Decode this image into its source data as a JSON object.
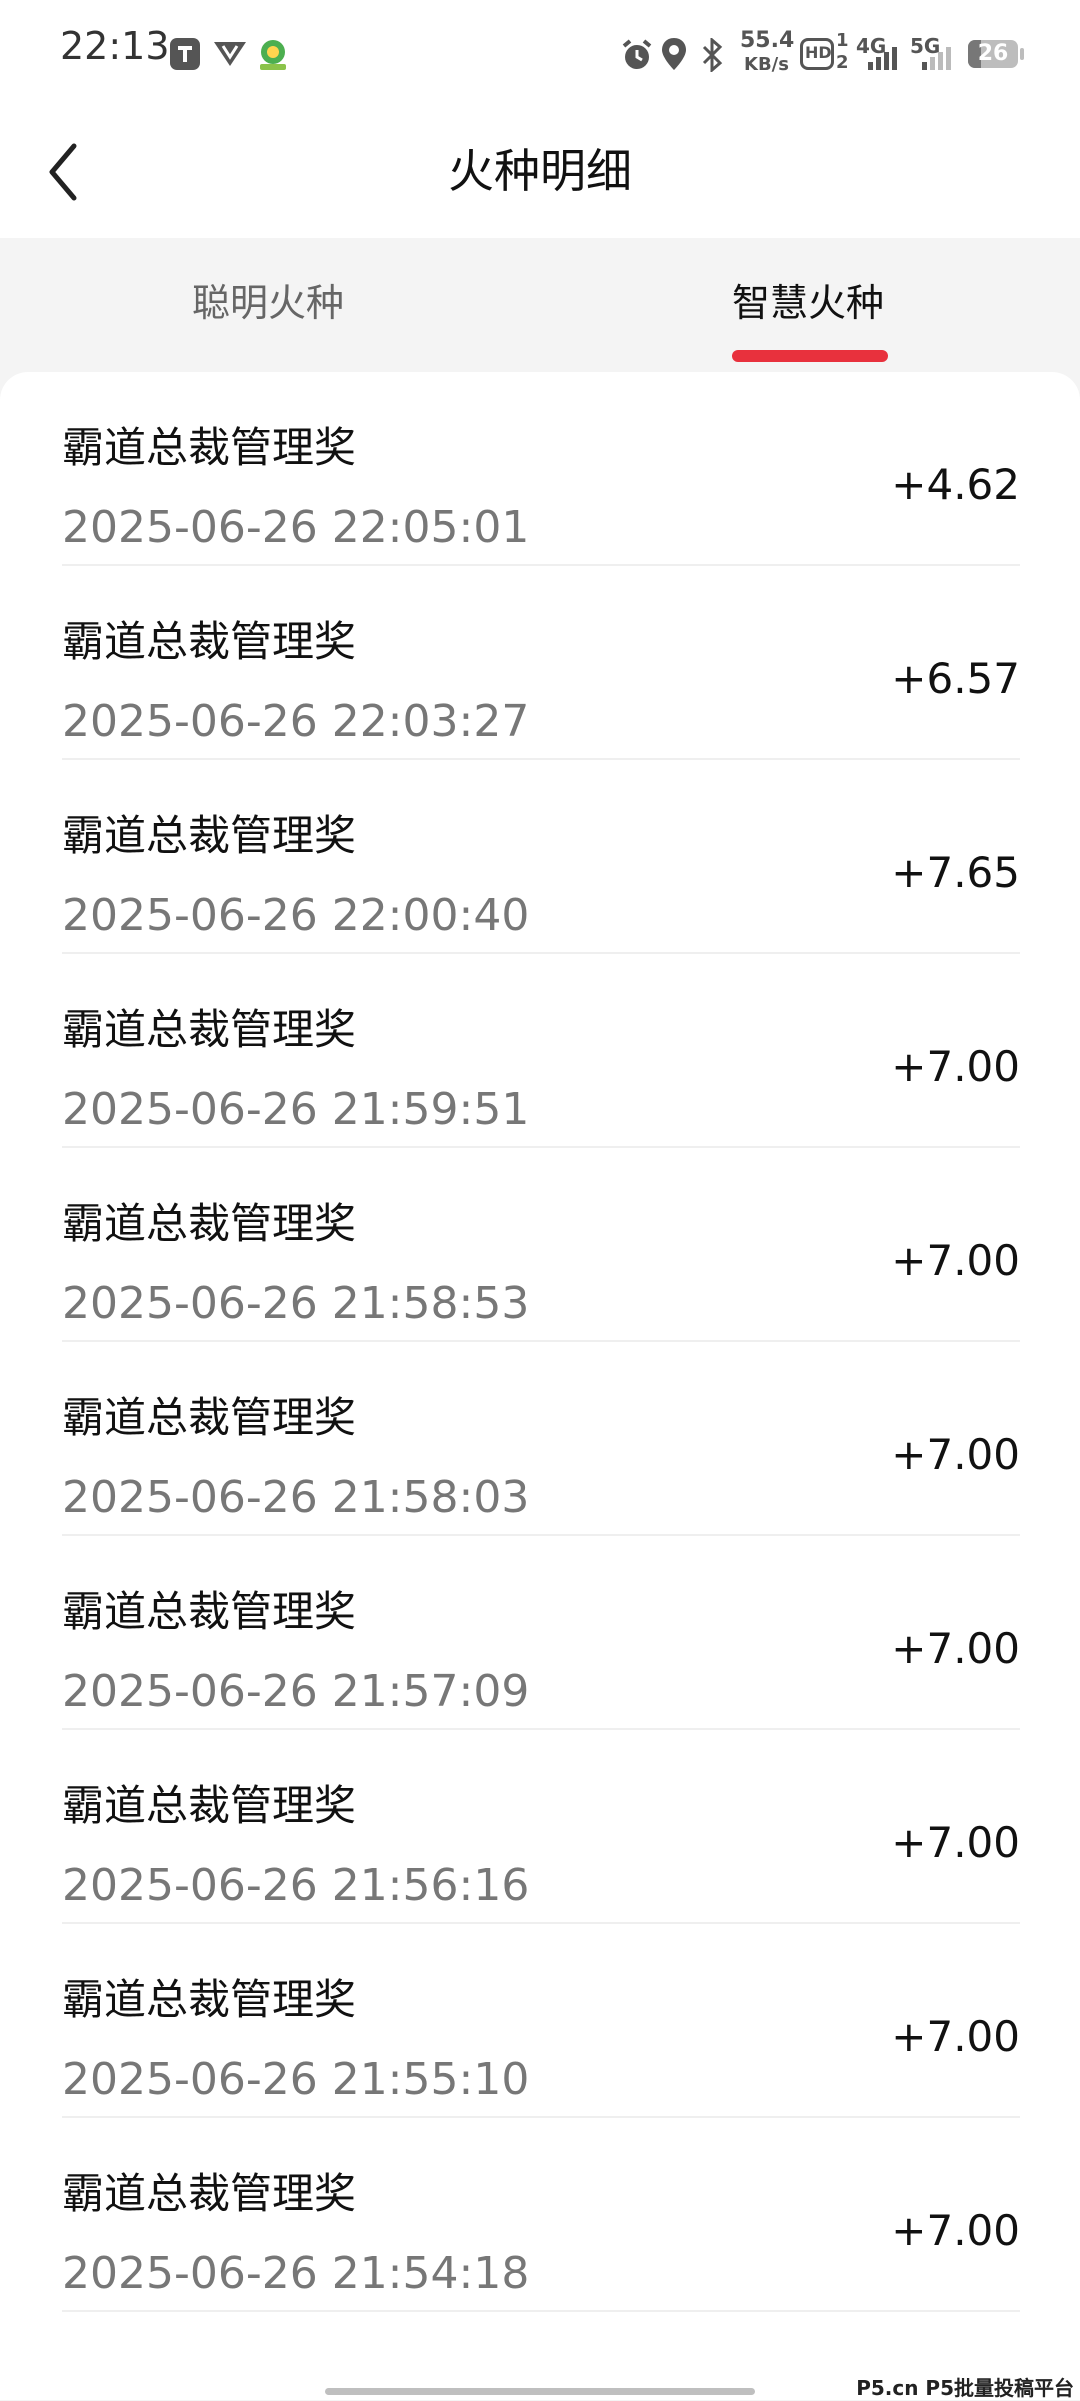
{
  "status_bar": {
    "time": "22:13",
    "speed_value": "55.4",
    "speed_unit": "KB/s",
    "hd": "HD",
    "sim_top": "1",
    "sim_bottom": "2",
    "net_4g": "4G",
    "net_5g": "5G",
    "battery": "26",
    "icons": [
      "shield-app-icon",
      "vpn-icon",
      "app-badge-icon",
      "alarm-icon",
      "location-icon",
      "bluetooth-icon",
      "signal-icon",
      "battery-icon"
    ]
  },
  "header": {
    "title": "火种明细",
    "back_icon": "chevron-left-icon"
  },
  "tabs": [
    {
      "label": "聪明火种",
      "active": false
    },
    {
      "label": "智慧火种",
      "active": true
    }
  ],
  "colors": {
    "accent": "#e8313d",
    "background": "#f4f4f4",
    "card": "#ffffff"
  },
  "records": [
    {
      "name": "霸道总裁管理奖",
      "time": "2025-06-26 22:05:01",
      "amount": "+4.62"
    },
    {
      "name": "霸道总裁管理奖",
      "time": "2025-06-26 22:03:27",
      "amount": "+6.57"
    },
    {
      "name": "霸道总裁管理奖",
      "time": "2025-06-26 22:00:40",
      "amount": "+7.65"
    },
    {
      "name": "霸道总裁管理奖",
      "time": "2025-06-26 21:59:51",
      "amount": "+7.00"
    },
    {
      "name": "霸道总裁管理奖",
      "time": "2025-06-26 21:58:53",
      "amount": "+7.00"
    },
    {
      "name": "霸道总裁管理奖",
      "time": "2025-06-26 21:58:03",
      "amount": "+7.00"
    },
    {
      "name": "霸道总裁管理奖",
      "time": "2025-06-26 21:57:09",
      "amount": "+7.00"
    },
    {
      "name": "霸道总裁管理奖",
      "time": "2025-06-26 21:56:16",
      "amount": "+7.00"
    },
    {
      "name": "霸道总裁管理奖",
      "time": "2025-06-26 21:55:10",
      "amount": "+7.00"
    },
    {
      "name": "霸道总裁管理奖",
      "time": "2025-06-26 21:54:18",
      "amount": "+7.00"
    }
  ],
  "watermark": "P5.cn P5批量投稿平台"
}
